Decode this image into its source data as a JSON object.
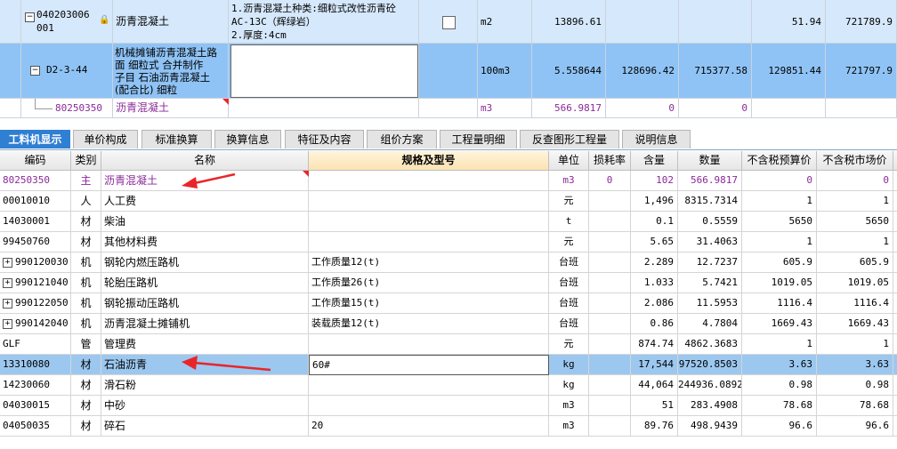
{
  "top_rows": [
    {
      "code": "040203006001",
      "name": "沥青混凝土",
      "features": [
        "1.沥青混凝土种类:细粒式改性沥青砼",
        "AC-13C（辉绿岩）",
        "2.厚度:4cm"
      ],
      "unit": "m2",
      "qty": "13896.61",
      "c1": "",
      "c2": "",
      "c3": "51.94",
      "c4": "721789.9"
    },
    {
      "code": "D2-3-44",
      "name": "机械摊铺沥青混凝土路面 细粒式 合并制作子目 石油沥青混凝土(配合比) 细粒",
      "name_lines": [
        "机械摊铺沥青混凝土路",
        "面 细粒式  合并制作",
        "子目 石油沥青混凝土",
        "(配合比) 细粒"
      ],
      "unit": "100m3",
      "qty": "5.558644",
      "c1": "128696.42",
      "c2": "715377.58",
      "c3": "129851.44",
      "c4": "721797.9"
    },
    {
      "code": "80250350",
      "name": "沥青混凝土",
      "unit": "m3",
      "qty": "566.9817",
      "c1": "0",
      "c2": "0",
      "c3": "",
      "c4": ""
    }
  ],
  "tabs": [
    "工料机显示",
    "单价构成",
    "标准换算",
    "换算信息",
    "特征及内容",
    "组价方案",
    "工程量明细",
    "反查图形工程量",
    "说明信息"
  ],
  "columns": [
    "编码",
    "类别",
    "名称",
    "规格及型号",
    "单位",
    "损耗率",
    "含量",
    "数量",
    "不含税预算价",
    "不含税市场价"
  ],
  "rows": [
    {
      "code": "80250350",
      "type": "主",
      "name": "沥青混凝土",
      "spec": "",
      "unit": "m3",
      "loss": "0",
      "content": "102",
      "qty": "566.9817",
      "budget": "0",
      "market": "0",
      "expand": false
    },
    {
      "code": "00010010",
      "type": "人",
      "name": "人工费",
      "spec": "",
      "unit": "元",
      "loss": "",
      "content": "1,496",
      "qty": "8315.7314",
      "budget": "1",
      "market": "1",
      "expand": false
    },
    {
      "code": "14030001",
      "type": "材",
      "name": "柴油",
      "spec": "",
      "unit": "t",
      "loss": "",
      "content": "0.1",
      "qty": "0.5559",
      "budget": "5650",
      "market": "5650",
      "expand": false
    },
    {
      "code": "99450760",
      "type": "材",
      "name": "其他材料费",
      "spec": "",
      "unit": "元",
      "loss": "",
      "content": "5.65",
      "qty": "31.4063",
      "budget": "1",
      "market": "1",
      "expand": false
    },
    {
      "code": "990120030",
      "type": "机",
      "name": "钢轮内燃压路机",
      "spec": "工作质量12(t)",
      "unit": "台班",
      "loss": "",
      "content": "2.289",
      "qty": "12.7237",
      "budget": "605.9",
      "market": "605.9",
      "expand": true
    },
    {
      "code": "990121040",
      "type": "机",
      "name": "轮胎压路机",
      "spec": "工作质量26(t)",
      "unit": "台班",
      "loss": "",
      "content": "1.033",
      "qty": "5.7421",
      "budget": "1019.05",
      "market": "1019.05",
      "expand": true
    },
    {
      "code": "990122050",
      "type": "机",
      "name": "钢轮振动压路机",
      "spec": "工作质量15(t)",
      "unit": "台班",
      "loss": "",
      "content": "2.086",
      "qty": "11.5953",
      "budget": "1116.4",
      "market": "1116.4",
      "expand": true
    },
    {
      "code": "990142040",
      "type": "机",
      "name": "沥青混凝土摊铺机",
      "spec": "装载质量12(t)",
      "unit": "台班",
      "loss": "",
      "content": "0.86",
      "qty": "4.7804",
      "budget": "1669.43",
      "market": "1669.43",
      "expand": true
    },
    {
      "code": "GLF",
      "type": "管",
      "name": "管理费",
      "spec": "",
      "unit": "元",
      "loss": "",
      "content": "874.74",
      "qty": "4862.3683",
      "budget": "1",
      "market": "1",
      "expand": false
    },
    {
      "code": "13310080",
      "type": "材",
      "name": "石油沥青",
      "spec": "60#",
      "unit": "kg",
      "loss": "",
      "content": "17,544",
      "qty": "97520.8503",
      "budget": "3.63",
      "market": "3.63",
      "expand": false
    },
    {
      "code": "14230060",
      "type": "材",
      "name": "滑石粉",
      "spec": "",
      "unit": "kg",
      "loss": "",
      "content": "44,064",
      "qty": "244936.0892",
      "budget": "0.98",
      "market": "0.98",
      "expand": false
    },
    {
      "code": "04030015",
      "type": "材",
      "name": "中砂",
      "spec": "",
      "unit": "m3",
      "loss": "",
      "content": "51",
      "qty": "283.4908",
      "budget": "78.68",
      "market": "78.68",
      "expand": false
    },
    {
      "code": "04050035",
      "type": "材",
      "name": "碎石",
      "spec": "20",
      "unit": "m3",
      "loss": "",
      "content": "89.76",
      "qty": "498.9439",
      "budget": "96.6",
      "market": "96.6",
      "expand": false
    }
  ],
  "toggle": {
    "minus": "−",
    "plus": "+"
  },
  "colors": {
    "selected": "#9cc8f0",
    "accent": "#2f7fd3",
    "purple": "#8a2a99",
    "arrow": "#e8262a"
  }
}
